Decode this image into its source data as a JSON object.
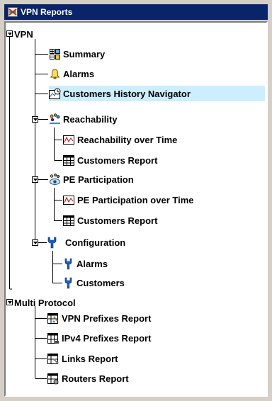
{
  "window": {
    "title": "VPN Reports"
  },
  "tree": {
    "vpn": {
      "label": "VPN",
      "summary": "Summary",
      "alarms": "Alarms",
      "customers_history": "Customers History Navigator",
      "reachability": {
        "label": "Reachability",
        "over_time": "Reachability over Time",
        "customers_report": "Customers Report"
      },
      "pe_participation": {
        "label": "PE Participation",
        "over_time": "PE Participation over Time",
        "customers_report": "Customers Report"
      },
      "configuration": {
        "label": "Configuration",
        "alarms": "Alarms",
        "customers": "Customers"
      }
    },
    "multi_protocol": {
      "label": "Multi Protocol",
      "vpn_prefixes": "VPN Prefixes Report",
      "ipv4_prefixes": "IPv4 Prefixes Report",
      "links": "Links Report",
      "routers": "Routers Report"
    },
    "selected": "Customers History Navigator"
  },
  "colors": {
    "titlebar": "#0a246a",
    "selection": "#cceeff",
    "tree_background": "#ffffff"
  }
}
